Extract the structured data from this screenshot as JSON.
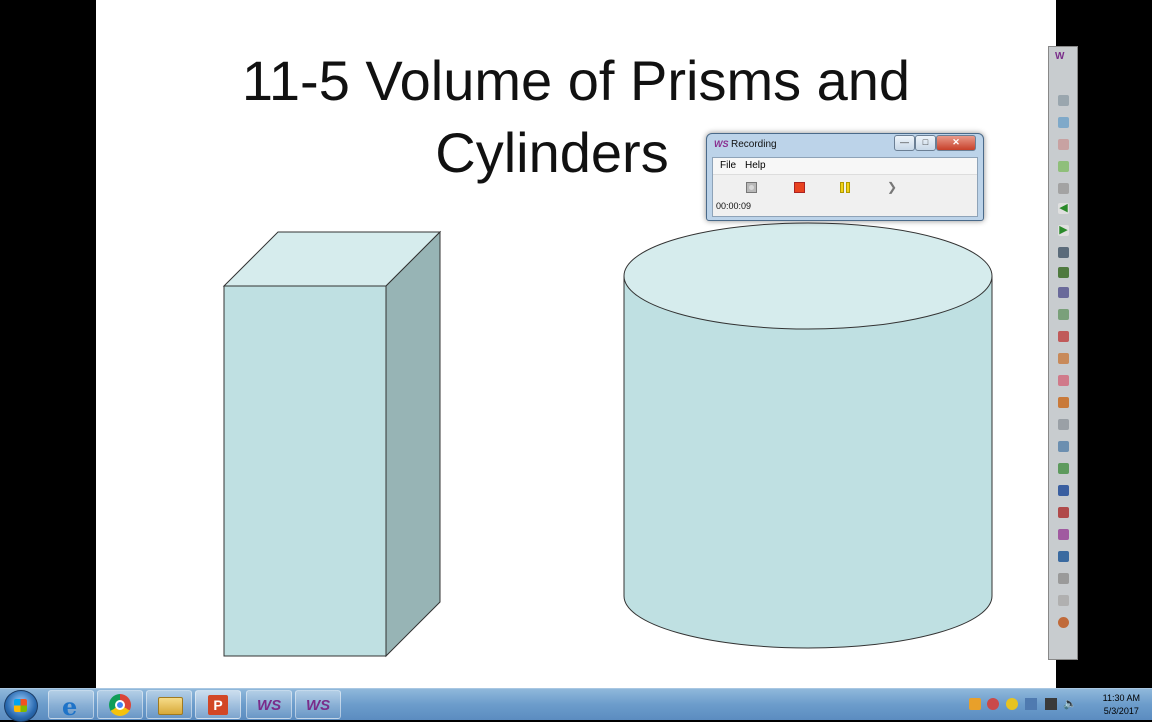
{
  "slide": {
    "title_line1": "11-5 Volume of Prisms and",
    "title_line2": "Cylinders"
  },
  "recording_window": {
    "app_logo": "WS",
    "title": "Recording",
    "minimize_label": "—",
    "maximize_label": "□",
    "close_label": "✕",
    "menu": {
      "file": "File",
      "help": "Help"
    },
    "controls": [
      "record-button",
      "stop-button",
      "pause-button",
      "next-button"
    ],
    "elapsed_time": "00:00:09"
  },
  "right_toolbar": {
    "logo": "W",
    "icons": [
      "pen-icon",
      "highlighter-icon",
      "select-icon",
      "eraser-icon",
      "shape-icon",
      "text-icon",
      "undo-icon",
      "redo-icon",
      "green-arrow-left-icon",
      "green-arrow-right-icon",
      "line-icon",
      "ruler-icon",
      "protractor-icon",
      "grid-icon",
      "table-icon",
      "chart-icon",
      "fill-icon",
      "image-icon",
      "page-icon",
      "copy-icon",
      "paste-icon",
      "delete-icon",
      "settings-icon",
      "exit-icon"
    ]
  },
  "taskbar": {
    "apps": [
      {
        "name": "internet-explorer",
        "label": "e"
      },
      {
        "name": "chrome",
        "label": ""
      },
      {
        "name": "file-explorer",
        "label": ""
      },
      {
        "name": "powerpoint",
        "label": "P"
      },
      {
        "name": "ws-app-1",
        "label": "WS"
      },
      {
        "name": "ws-app-2",
        "label": "WS"
      }
    ],
    "clock_time": "11:30 AM",
    "clock_date": "5/3/2017"
  },
  "colors": {
    "shape_fill": "#bfe0e2",
    "shape_side": "#97b4b5",
    "cylinder_top": "#d6eced",
    "record_red": "#e8421f",
    "pause_yellow": "#f3d21a"
  }
}
